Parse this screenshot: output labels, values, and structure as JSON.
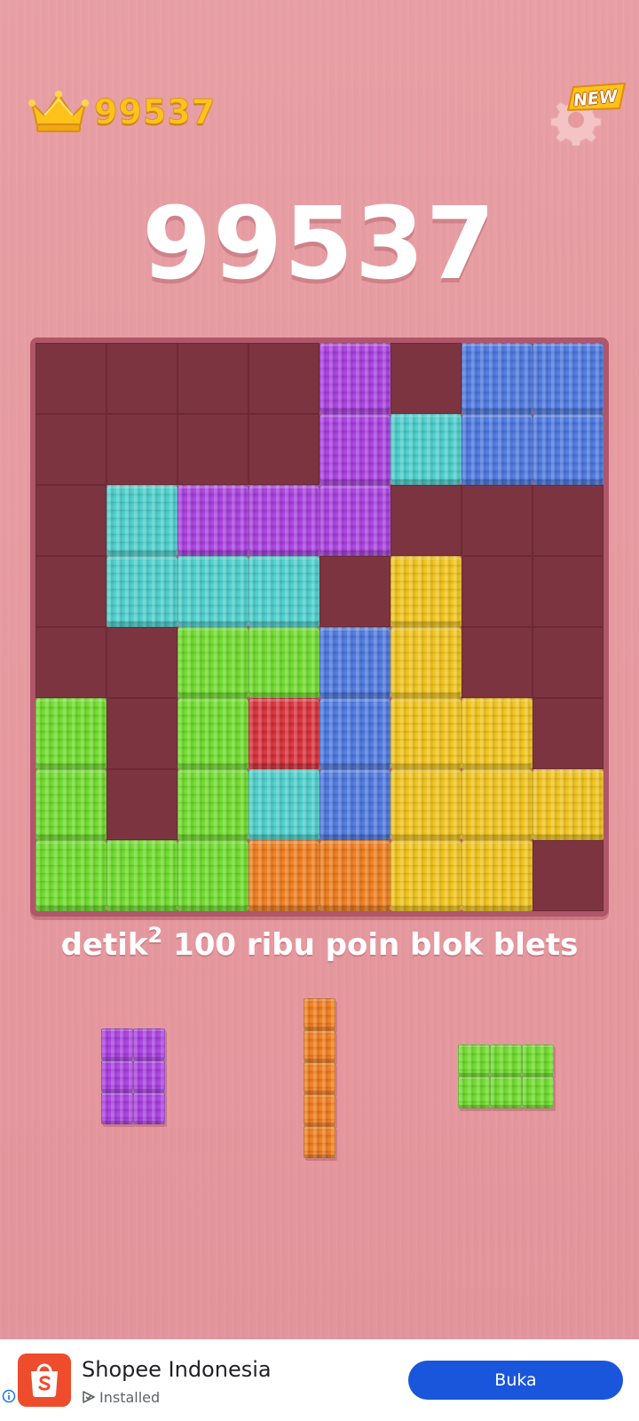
{
  "hud": {
    "best_score": "99537",
    "crown_icon": "crown-icon",
    "settings_icon": "gear-icon",
    "new_badge": "NEW",
    "score": "99537"
  },
  "board": {
    "size": 8,
    "colors": {
      "purple": "#a93fe0",
      "blue": "#4d78e0",
      "cyan": "#4ccfcc",
      "green": "#6fdc2c",
      "yellow": "#f1c41c",
      "red": "#d8303a",
      "orange": "#ef7d1e",
      "empty": "#7c3440"
    },
    "rows": [
      [
        "",
        "",
        "",
        "",
        "purple",
        "",
        "blue",
        "blue"
      ],
      [
        "",
        "",
        "",
        "",
        "purple",
        "cyan",
        "blue",
        "blue"
      ],
      [
        "",
        "cyan",
        "purple",
        "purple",
        "purple",
        "",
        "",
        ""
      ],
      [
        "",
        "cyan",
        "cyan",
        "cyan",
        "",
        "yellow",
        "",
        ""
      ],
      [
        "",
        "",
        "green",
        "green",
        "blue",
        "yellow",
        "",
        ""
      ],
      [
        "green",
        "",
        "green",
        "red",
        "blue",
        "yellow",
        "yellow",
        ""
      ],
      [
        "green",
        "",
        "green",
        "cyan",
        "blue",
        "yellow",
        "yellow",
        "yellow"
      ],
      [
        "green",
        "green",
        "green",
        "orange",
        "orange",
        "yellow",
        "yellow",
        ""
      ]
    ]
  },
  "caption": {
    "text_before": "detik",
    "superscript": "2",
    "text_after": " 100 ribu poin blok blets"
  },
  "tray": [
    {
      "name": "tray-piece-purple",
      "color": "purple",
      "cols": 2,
      "rows": 3
    },
    {
      "name": "tray-piece-orange",
      "color": "orange",
      "cols": 1,
      "rows": 5
    },
    {
      "name": "tray-piece-green",
      "color": "green",
      "cols": 3,
      "rows": 2
    }
  ],
  "ad": {
    "app_name": "Shopee Indonesia",
    "status": "Installed",
    "button_label": "Buka",
    "info_icon": "info-icon",
    "logo_icon": "shopee-bag-icon",
    "status_icon": "play-store-icon"
  }
}
